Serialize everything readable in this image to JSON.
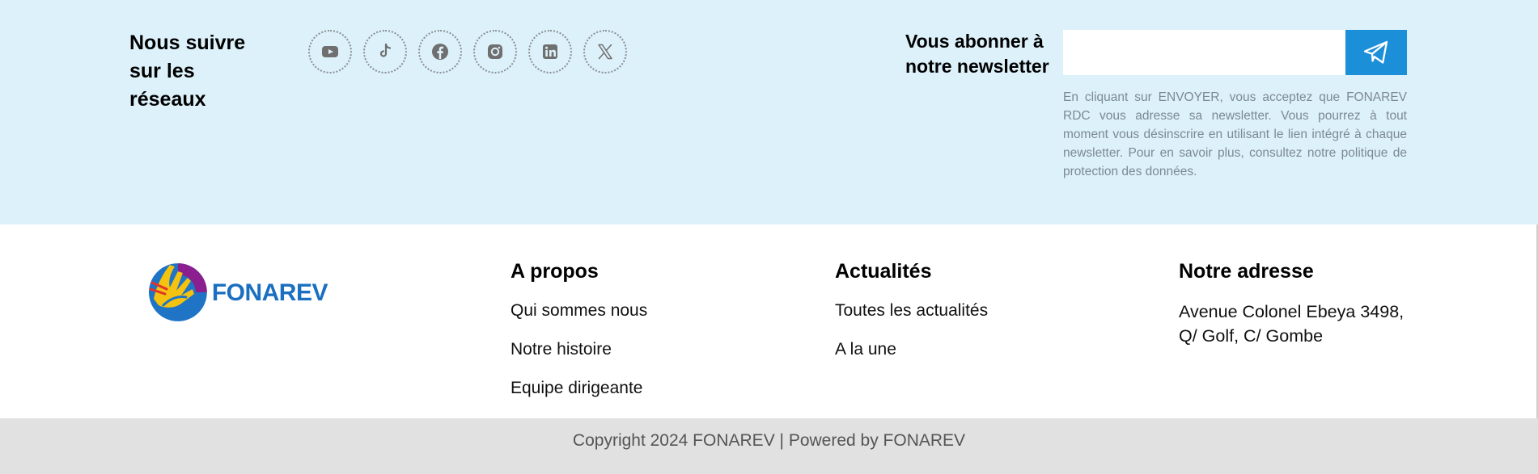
{
  "follow": {
    "title": "Nous suivre sur les réseaux",
    "networks": [
      {
        "name": "YouTube",
        "icon": "youtube-icon"
      },
      {
        "name": "TikTok",
        "icon": "tiktok-icon"
      },
      {
        "name": "Facebook",
        "icon": "facebook-icon"
      },
      {
        "name": "Instagram",
        "icon": "instagram-icon"
      },
      {
        "name": "LinkedIn",
        "icon": "linkedin-icon"
      },
      {
        "name": "X",
        "icon": "x-icon"
      }
    ]
  },
  "newsletter": {
    "title": "Vous abonner à notre newsletter",
    "email_value": "",
    "send_icon": "paper-plane-icon",
    "note": "En cliquant sur ENVOYER, vous acceptez que FONAREV RDC vous adresse sa newsletter. Vous pourrez à tout moment vous désinscrire en utilisant le lien intégré à chaque newsletter. Pour en savoir plus, consultez notre politique de protection des données."
  },
  "brand": {
    "name": "FONAREV"
  },
  "about": {
    "title": "A propos",
    "links": [
      "Qui sommes nous",
      "Notre histoire",
      "Equipe dirigeante"
    ]
  },
  "news": {
    "title": "Actualités",
    "links": [
      "Toutes les actualités",
      "A la une"
    ]
  },
  "address": {
    "title": "Notre adresse",
    "text": "Avenue Colonel Ebeya 3498, Q/ Golf, C/ Gombe"
  },
  "footer": {
    "copyright": "Copyright 2024 FONAREV | Powered by FONAREV"
  },
  "colors": {
    "top_band": "#ddf1fa",
    "send_button": "#1c8fd9",
    "bottom_band": "#e1e1e1",
    "logo_blue": "#1a6fc0"
  }
}
